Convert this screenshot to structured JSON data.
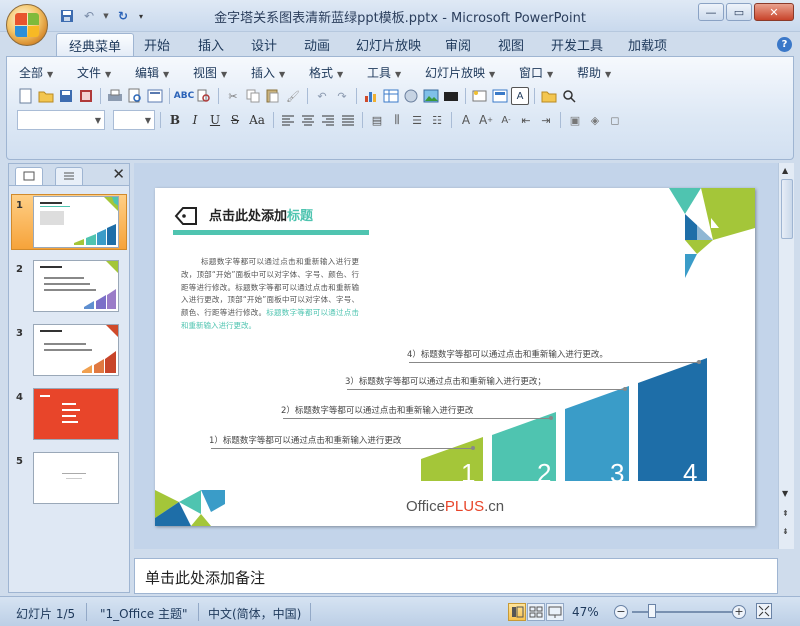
{
  "window": {
    "title": "金字塔关系图表清新蓝绿ppt模板.pptx - Microsoft PowerPoint"
  },
  "ribbon_tabs": [
    "经典菜单",
    "开始",
    "插入",
    "设计",
    "动画",
    "幻灯片放映",
    "审阅",
    "视图",
    "开发工具",
    "加载项"
  ],
  "menu_bar": [
    "全部",
    "文件",
    "编辑",
    "视图",
    "插入",
    "格式",
    "工具",
    "幻灯片放映",
    "窗口",
    "帮助"
  ],
  "format_labels": {
    "bold": "B",
    "italic": "I",
    "underline": "U",
    "strike": "S",
    "case": "Aa"
  },
  "slide": {
    "title_black": "点击此处添加",
    "title_green": "标题",
    "body_text": "标题数字等都可以通过点击和重新输入进行更改，顶部“开始”面板中可以对字体、字号、颜色、行距等进行修改。标题数字等都可以通过点击和重新输入进行更改，顶部“开始”面板中可以对字体、字号、颜色、行距等进行修改。",
    "body_green": "标题数字等都可以通过点击和重新输入进行更改。",
    "steps": [
      {
        "label": "1）标题数字等都可以通过点击和重新输入进行更改",
        "num": "1"
      },
      {
        "label": "2）标题数字等都可以通过点击和重新输入进行更改",
        "num": "2"
      },
      {
        "label": "3）标题数字等都可以通过点击和重新输入进行更改；",
        "num": "3"
      },
      {
        "label": "4）标题数字等都可以通过点击和重新输入进行更改。",
        "num": "4"
      }
    ],
    "logo_office": "Office",
    "logo_plus": "PLUS",
    "logo_cn": ".cn",
    "colors": {
      "lime": "#a4c639",
      "teal": "#4fc4b0",
      "blue_mid": "#3a9cc8",
      "blue_dark": "#1e6ea8"
    }
  },
  "thumbnails": [
    "1",
    "2",
    "3",
    "4",
    "5"
  ],
  "notes": {
    "placeholder": "单击此处添加备注"
  },
  "status": {
    "slide_info": "幻灯片 1/5",
    "theme": "\"1_Office 主题\"",
    "language": "中文(简体，中国)",
    "zoom": "47%"
  }
}
